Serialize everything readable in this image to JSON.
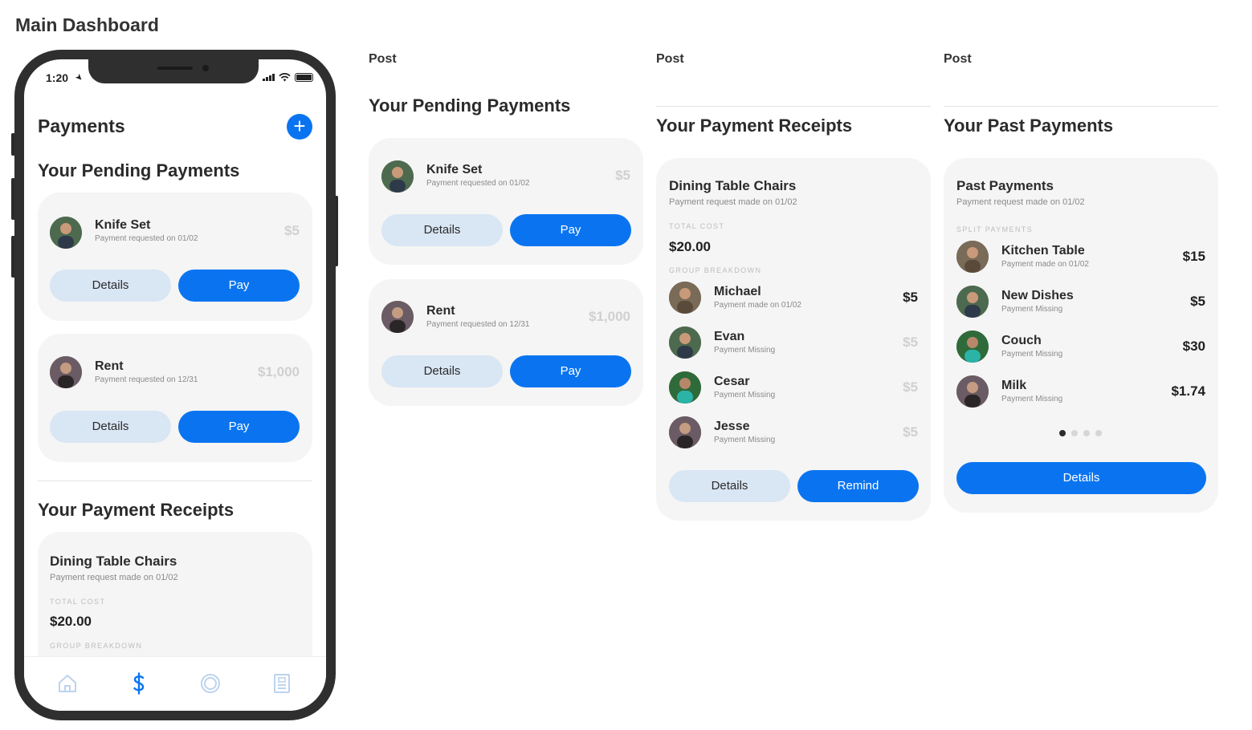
{
  "board_title": "Main Dashboard",
  "phone": {
    "status": {
      "time": "1:20"
    },
    "title": "Payments",
    "add_icon": "plus-icon",
    "pending_heading": "Your Pending Payments",
    "pending": [
      {
        "name": "Knife Set",
        "sub": "Payment requested on 01/02",
        "amount": "$5",
        "details_label": "Details",
        "pay_label": "Pay"
      },
      {
        "name": "Rent",
        "sub": "Payment requested on 12/31",
        "amount": "$1,000",
        "details_label": "Details",
        "pay_label": "Pay"
      }
    ],
    "receipts_heading": "Your Payment Receipts",
    "receipt": {
      "title": "Dining Table Chairs",
      "sub": "Payment request made on 01/02",
      "total_label": "TOTAL COST",
      "total": "$20.00",
      "breakdown_label": "GROUP BREAKDOWN"
    },
    "tabs": [
      {
        "icon": "home-icon"
      },
      {
        "icon": "dollar-icon",
        "active": true
      },
      {
        "icon": "circle-icon"
      },
      {
        "icon": "document-icon"
      }
    ]
  },
  "panels": {
    "pending": {
      "label": "Post",
      "heading": "Your Pending Payments",
      "items": [
        {
          "name": "Knife Set",
          "sub": "Payment requested on 01/02",
          "amount": "$5",
          "details_label": "Details",
          "pay_label": "Pay"
        },
        {
          "name": "Rent",
          "sub": "Payment requested on 12/31",
          "amount": "$1,000",
          "details_label": "Details",
          "pay_label": "Pay"
        }
      ]
    },
    "receipts": {
      "label": "Post",
      "heading": "Your Payment Receipts",
      "card": {
        "title": "Dining Table Chairs",
        "sub": "Payment request made on 01/02",
        "total_label": "TOTAL COST",
        "total": "$20.00",
        "breakdown_label": "GROUP BREAKDOWN",
        "people": [
          {
            "name": "Michael",
            "sub": "Payment made on 01/02",
            "amount": "$5",
            "paid": true
          },
          {
            "name": "Evan",
            "sub": "Payment Missing",
            "amount": "$5",
            "paid": false
          },
          {
            "name": "Cesar",
            "sub": "Payment Missing",
            "amount": "$5",
            "paid": false
          },
          {
            "name": "Jesse",
            "sub": "Payment Missing",
            "amount": "$5",
            "paid": false
          }
        ],
        "details_label": "Details",
        "remind_label": "Remind"
      }
    },
    "past": {
      "label": "Post",
      "heading": "Your Past Payments",
      "card": {
        "title": "Past Payments",
        "sub": "Payment request made on 01/02",
        "split_label": "SPLIT PAYMENTS",
        "items": [
          {
            "name": "Kitchen Table",
            "sub": "Payment made on 01/02",
            "amount": "$15"
          },
          {
            "name": "New Dishes",
            "sub": "Payment Missing",
            "amount": "$5"
          },
          {
            "name": "Couch",
            "sub": "Payment Missing",
            "amount": "$30"
          },
          {
            "name": "Milk",
            "sub": "Payment Missing",
            "amount": "$1.74"
          }
        ],
        "page_count": 4,
        "active_page": 1,
        "details_label": "Details"
      }
    }
  },
  "colors": {
    "accent": "#0a74f0",
    "secondary_button": "#d9e6f4",
    "card_bg": "#f5f5f5"
  }
}
